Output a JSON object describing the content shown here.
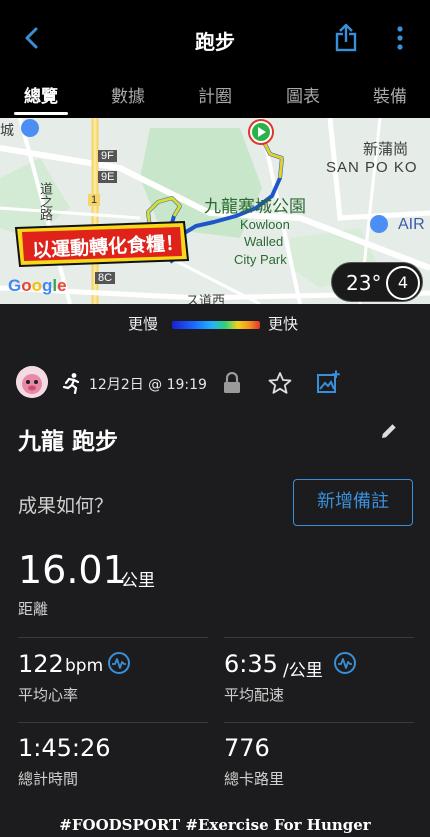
{
  "header": {
    "title": "跑步"
  },
  "tabs": [
    {
      "label": "總覽"
    },
    {
      "label": "數據"
    },
    {
      "label": "計圈"
    },
    {
      "label": "圖表"
    },
    {
      "label": "裝備"
    }
  ],
  "map": {
    "labels": {
      "san_po_kong_zh": "新蒲崗",
      "san_po_kong_en": "SAN PO KO",
      "park_zh": "九龍寨城公園",
      "park_en1": "Kowloon",
      "park_en2": "Walled",
      "park_en3": "City Park",
      "air": "AIR",
      "road_9f": "9F",
      "road_9e": "9E",
      "road_1": "1",
      "road_8c": "8C",
      "partial_cheng": "城",
      "partial_road": "道之路",
      "partial_bottom": "ス道西"
    },
    "sticker_text": "以運動轉化食糧！",
    "provider": "Google",
    "temperature": "23°",
    "weather_number": "4"
  },
  "legend": {
    "slow": "更慢",
    "fast": "更快"
  },
  "activity": {
    "date": "12月2日 @ 19:19",
    "title": "九龍 跑步",
    "result_prompt": "成果如何？",
    "add_note": "新增備註"
  },
  "stats": {
    "distance": {
      "value": "16.01",
      "unit": "公里",
      "label": "距離"
    },
    "heart_rate": {
      "value": "122",
      "unit": "bpm",
      "label": "平均心率"
    },
    "pace": {
      "value": "6:35",
      "unit": "/公里",
      "label": "平均配速"
    },
    "total_time": {
      "value": "1:45:26",
      "label": "總計時間"
    },
    "calories": {
      "value": "776",
      "label": "總卡路里"
    }
  },
  "footer": {
    "text": "#FOODSPORT #Exercise For Hunger"
  },
  "colors": {
    "accent": "#3a8fd9",
    "route": "#2f6fe0",
    "background": "#1c1c1e"
  }
}
